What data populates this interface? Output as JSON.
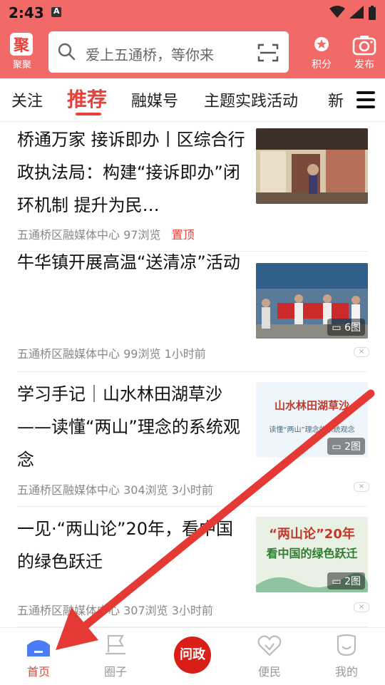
{
  "status": {
    "time": "2:43",
    "app_badge": "A"
  },
  "header": {
    "logo_label": "聚聚",
    "search_placeholder": "爱上五通桥，等你来",
    "points_label": "积分",
    "publish_label": "发布"
  },
  "tabs": [
    {
      "label": "关注"
    },
    {
      "label": "推荐"
    },
    {
      "label": "融媒号"
    },
    {
      "label": "主题实践活动"
    },
    {
      "label": "新"
    }
  ],
  "feed": [
    {
      "title": "桥通万家 接诉即办丨区综合行政执法局：构建“接诉即办”闭环机制 提升为民…",
      "source": "五通桥区融媒体中心",
      "views": "97浏览",
      "tag": "置顶"
    },
    {
      "title": "牛华镇开展高温“送清凉”活动",
      "source": "五通桥区融媒体中心",
      "views": "99浏览",
      "time": "1小时前",
      "image_count": "6图"
    },
    {
      "title": "学习手记｜山水林田湖草沙——读懂“两山”理念的系统观念",
      "source": "五通桥区融媒体中心",
      "views": "304浏览",
      "time": "3小时前",
      "image_count": "2图",
      "thumb_text": "山水林田湖草沙",
      "thumb_sub": "读懂“两山”理念的系统观念"
    },
    {
      "title": "一见·“两山论”20年，看中国的绿色跃迁",
      "source": "五通桥区融媒体中心",
      "views": "307浏览",
      "time": "3小时前",
      "image_count": "2图",
      "thumb_text": "“两山论”20年",
      "thumb_sub": "看中国的绿色跃迁"
    }
  ],
  "bottom_nav": [
    {
      "label": "首页"
    },
    {
      "label": "圈子"
    },
    {
      "label": "问政"
    },
    {
      "label": "便民"
    },
    {
      "label": "我的"
    }
  ],
  "colors": {
    "brand": "#f26a67",
    "accent": "#e8413b",
    "annotation_arrow": "#e53935"
  }
}
